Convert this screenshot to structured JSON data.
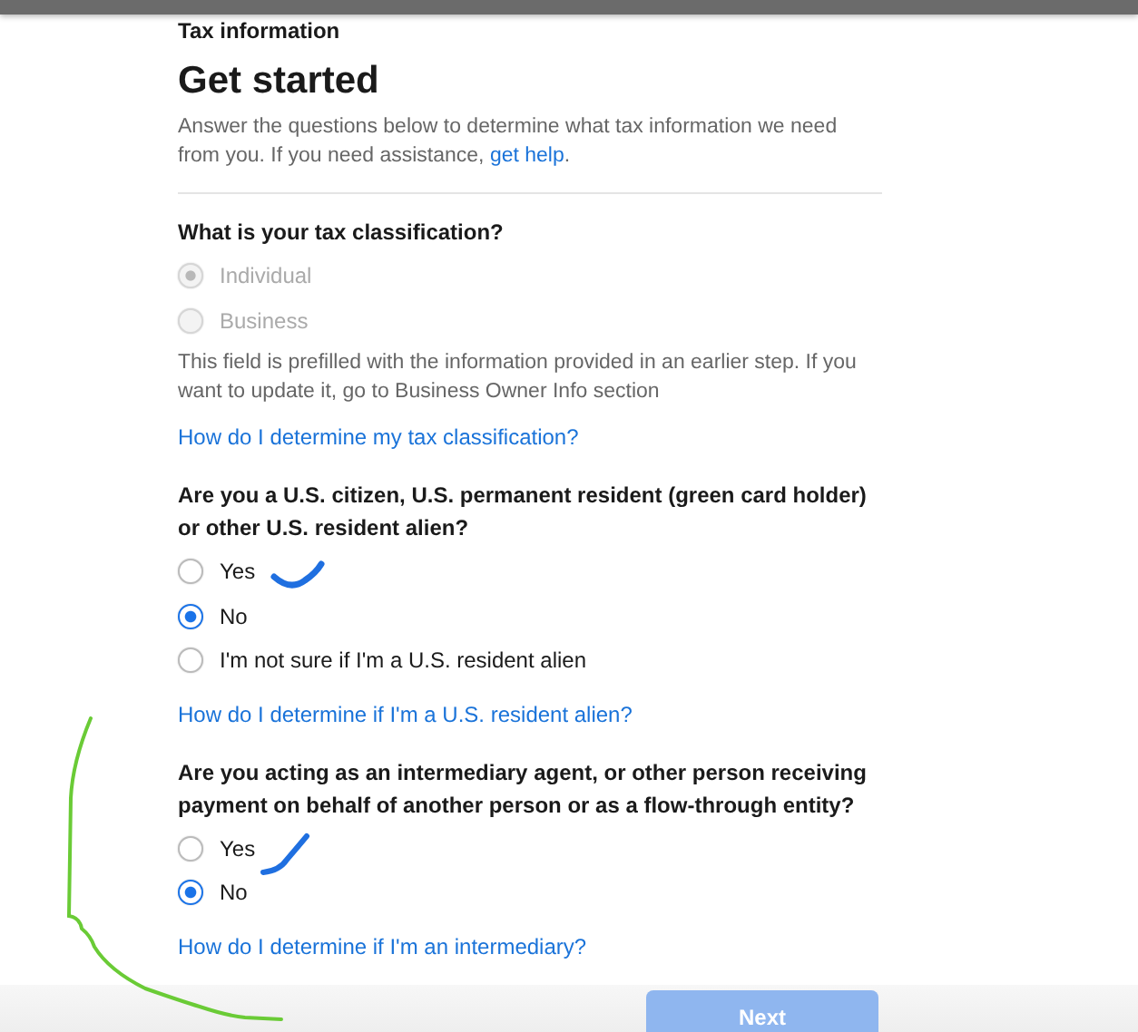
{
  "page_title": "Tax information",
  "heading": "Get started",
  "intro": {
    "text": "Answer the questions below to determine what tax information we need from you. If you need assistance,",
    "link": "get help",
    "end": "."
  },
  "questions": [
    {
      "question": "What is your tax classification?",
      "options": [
        {
          "label": "Individual",
          "selected": true,
          "disabled": true
        },
        {
          "label": "Business",
          "selected": false,
          "disabled": true
        }
      ],
      "note": "This field is prefilled with the information provided in an earlier step. If you want to update it, go to Business Owner Info section",
      "help_link": "How do I determine my tax classification?"
    },
    {
      "question": "Are you a U.S. citizen, U.S. permanent resident (green card holder) or other U.S. resident alien?",
      "options": [
        {
          "label": "Yes",
          "selected": false,
          "disabled": false
        },
        {
          "label": "No",
          "selected": true,
          "disabled": false
        },
        {
          "label": "I'm not sure if I'm a U.S. resident alien",
          "selected": false,
          "disabled": false
        }
      ],
      "help_link": "How do I determine if I'm a U.S. resident alien?"
    },
    {
      "question": "Are you acting as an intermediary agent, or other person receiving payment on behalf of another person or as a flow-through entity?",
      "options": [
        {
          "label": "Yes",
          "selected": false,
          "disabled": false
        },
        {
          "label": "No",
          "selected": true,
          "disabled": false
        }
      ],
      "help_link": "How do I determine if I'm an intermediary?"
    }
  ],
  "next_button": {
    "label": "Next",
    "disabled": true
  }
}
